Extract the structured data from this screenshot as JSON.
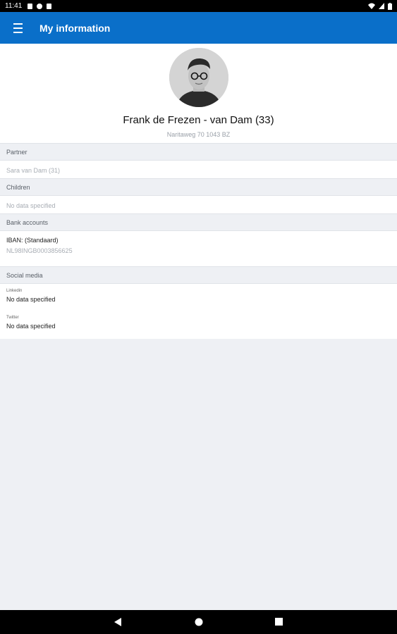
{
  "status_bar": {
    "time": "11:41"
  },
  "app_bar": {
    "title": "My information",
    "menu_icon": "menu-icon"
  },
  "profile": {
    "name": "Frank de Frezen - van Dam (33)",
    "address": "Naritaweg 70 1043 BZ"
  },
  "partner": {
    "header": "Partner",
    "value": "Sara van Dam (31)"
  },
  "children": {
    "header": "Children",
    "value": "No data specified"
  },
  "bank_accounts": {
    "header": "Bank accounts",
    "label": "IBAN: (Standaard)",
    "iban": "NL98INGB0003856625"
  },
  "social_media": {
    "header": "Social media",
    "linkedin_label": "Linkedin",
    "linkedin_value": "No data specified",
    "twitter_label": "Twitter",
    "twitter_value": "No data specified"
  },
  "colors": {
    "app_bar": "#0a6fc9",
    "background": "#eef0f4"
  }
}
